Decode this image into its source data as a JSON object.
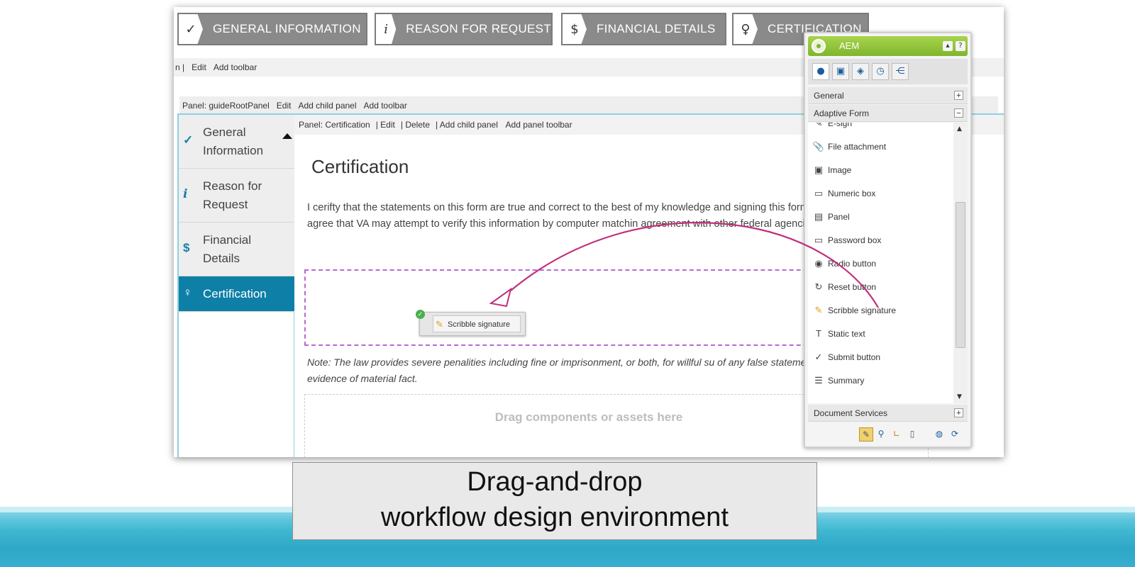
{
  "wizard_tabs": [
    {
      "icon": "✓",
      "label": "GENERAL INFORMATION"
    },
    {
      "icon": "i",
      "label": "REASON FOR REQUEST"
    },
    {
      "icon": "$",
      "label": "FINANCIAL DETAILS"
    },
    {
      "icon": "♀",
      "label": "CERTIFICATION"
    }
  ],
  "toolbar1": {
    "prefix": "n |",
    "edit": "Edit",
    "add_toolbar": "Add toolbar"
  },
  "toolbar2": {
    "panel": "Panel: guideRootPanel",
    "edit": "Edit",
    "add_child": "Add child panel",
    "add_toolbar": "Add toolbar"
  },
  "nav": [
    {
      "icon": "✓",
      "label": "General Information"
    },
    {
      "icon": "i",
      "label": "Reason for Request"
    },
    {
      "icon": "$",
      "label": "Financial Details"
    },
    {
      "icon": "♀",
      "label": "Certification"
    }
  ],
  "panelbar": {
    "panel": "Panel: Certification",
    "edit": "Edit",
    "delete": "Delete",
    "add_child": "Add child panel",
    "add_toolbar": "Add panel toolbar"
  },
  "main": {
    "title": "Certification",
    "paragraph": "I cerifty that the statements on this form are true and correct to the best of my knowledge and signing this form, I agree that VA may attempt to verify this information by computer matchin agreement with other federal agencies.",
    "dragged_component": "Scribble signature",
    "note": "Note: The law provides severe penalities including fine or imprisonment, or both, for willful su of any false statement or evidence of material fact.",
    "drop_hint": "Drag components or assets here"
  },
  "sidekick": {
    "title": "AEM",
    "sections": {
      "general": "General",
      "adaptive_form": "Adaptive Form",
      "document_services": "Document Services"
    },
    "items": [
      {
        "icon": "✎",
        "label": "E-sign"
      },
      {
        "icon": "📎",
        "label": "File attachment"
      },
      {
        "icon": "▣",
        "label": "Image"
      },
      {
        "icon": "▭",
        "label": "Numeric box"
      },
      {
        "icon": "▤",
        "label": "Panel"
      },
      {
        "icon": "▭",
        "label": "Password box"
      },
      {
        "icon": "◉",
        "label": "Radio button"
      },
      {
        "icon": "↻",
        "label": "Reset button"
      },
      {
        "icon": "✎",
        "label": "Scribble signature"
      },
      {
        "icon": "T",
        "label": "Static text"
      },
      {
        "icon": "✓",
        "label": "Submit button"
      },
      {
        "icon": "☰",
        "label": "Summary"
      }
    ]
  },
  "caption": {
    "line1": "Drag-and-drop",
    "line2": "workflow design environment"
  },
  "colors": {
    "accent": "#0e7fa6",
    "dropzone": "#b86ad0",
    "arrow": "#c0307a",
    "sidekick_header": "#8cc43a"
  }
}
